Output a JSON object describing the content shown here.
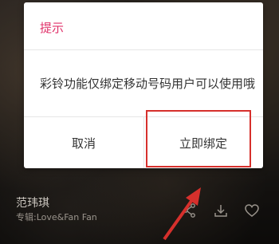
{
  "dialog": {
    "title": "提示",
    "message": "彩铃功能仅绑定移动号码用户可以使用哦",
    "cancel_label": "取消",
    "confirm_label": "立即绑定"
  },
  "player": {
    "song_title": "范玮琪",
    "album": "专辑:Love&Fan Fan"
  },
  "icons": [
    "share-icon",
    "download-icon",
    "heart-icon"
  ],
  "colors": {
    "dialog_title": "#e0326a",
    "highlight": "#d6302c"
  }
}
